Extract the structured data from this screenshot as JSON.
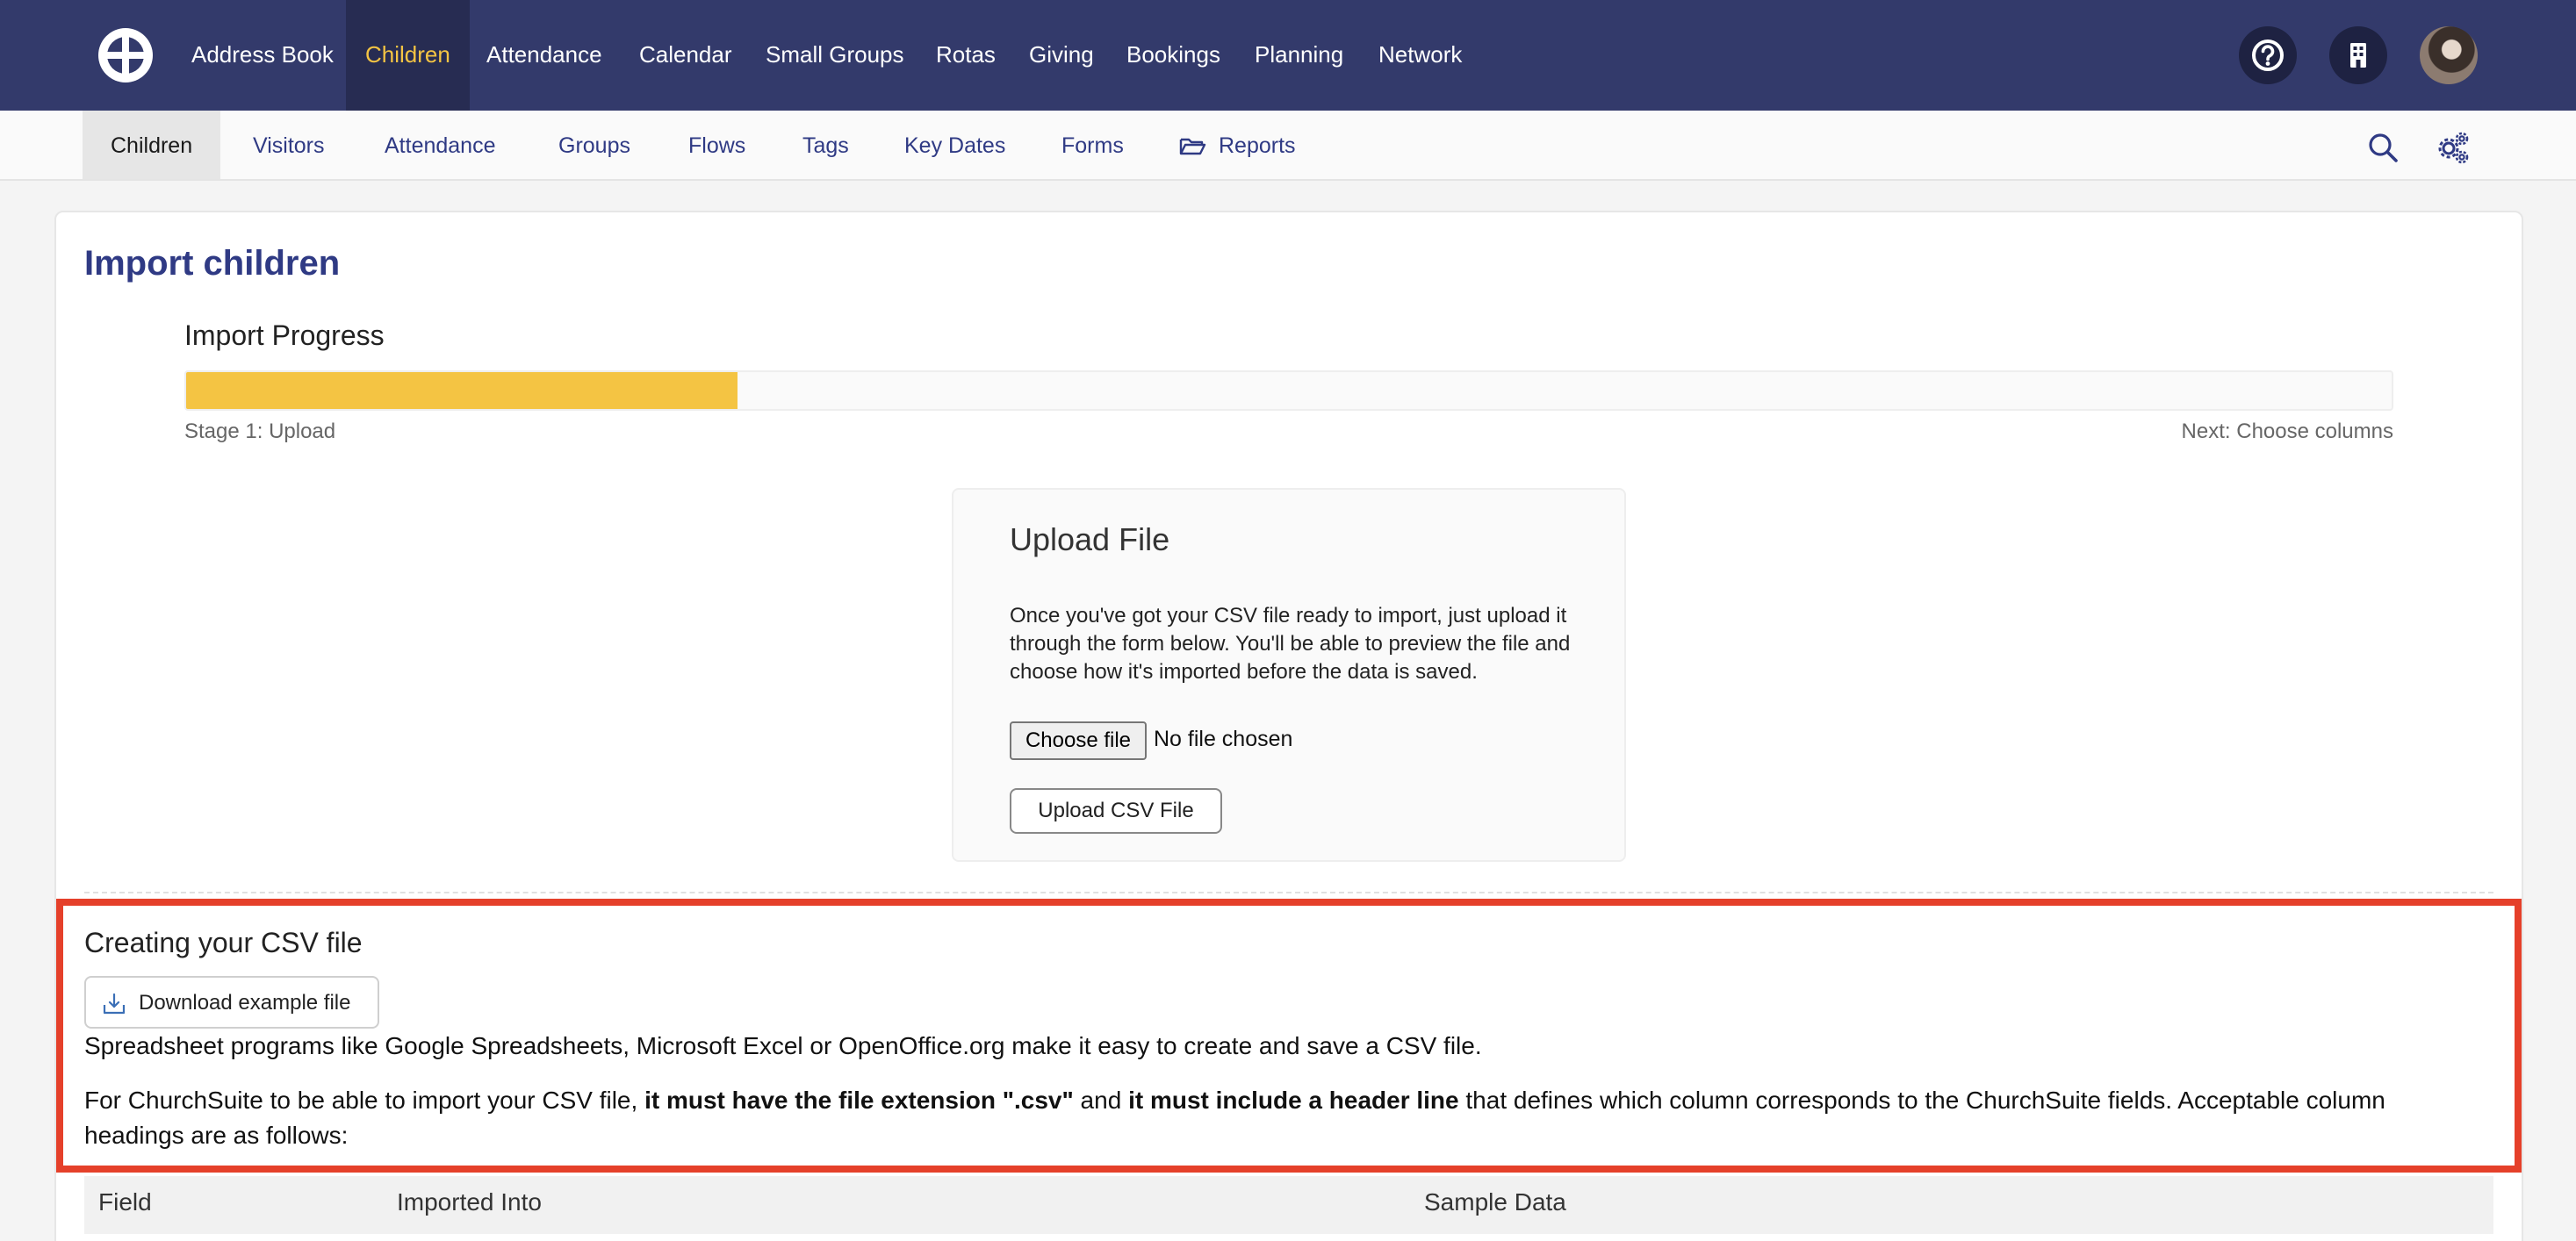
{
  "topnav": {
    "items": [
      {
        "label": "Address Book"
      },
      {
        "label": "Children",
        "active": true
      },
      {
        "label": "Attendance"
      },
      {
        "label": "Calendar"
      },
      {
        "label": "Small Groups"
      },
      {
        "label": "Rotas"
      },
      {
        "label": "Giving"
      },
      {
        "label": "Bookings"
      },
      {
        "label": "Planning"
      },
      {
        "label": "Network"
      }
    ],
    "icons": [
      "logo-icon",
      "help-icon",
      "building-icon",
      "avatar"
    ]
  },
  "subnav": {
    "items": [
      {
        "label": "Children",
        "active": true
      },
      {
        "label": "Visitors"
      },
      {
        "label": "Attendance"
      },
      {
        "label": "Groups"
      },
      {
        "label": "Flows"
      },
      {
        "label": "Tags"
      },
      {
        "label": "Key Dates"
      },
      {
        "label": "Forms"
      },
      {
        "label": "Reports",
        "icon": "folder-open-icon"
      }
    ],
    "icons": [
      "search-icon",
      "gear-icon"
    ]
  },
  "page": {
    "title": "Import children",
    "progress": {
      "title": "Import Progress",
      "fraction": 0.25,
      "stage": "Stage 1: Upload",
      "next": "Next: Choose columns"
    },
    "upload": {
      "title": "Upload File",
      "description": "Once you've got your CSV file ready to import, just upload it through the form below. You'll be able to preview the file and choose how it's imported before the data is saved.",
      "choose_label": "Choose file",
      "no_file": "No file chosen",
      "submit_label": "Upload CSV File"
    },
    "csv": {
      "title": "Creating your CSV file",
      "download_label": "Download example file",
      "para1": "Spreadsheet programs like Google Spreadsheets, Microsoft Excel or OpenOffice.org make it easy to create and save a CSV file.",
      "para2_a": "For ChurchSuite to be able to import your CSV file, ",
      "para2_b": "it must have the file extension \".csv\"",
      "para2_c": " and ",
      "para2_d": "it must include a header line",
      "para2_e": " that defines which column corresponds to the ChurchSuite fields. Acceptable column headings are as follows:"
    },
    "table": {
      "headers": [
        "Field",
        "Imported Into",
        "Sample Data"
      ]
    }
  },
  "colors": {
    "nav_bg": "#333a6b",
    "accent": "#f4c443",
    "link": "#2f3a84",
    "highlight": "#e5402a"
  }
}
